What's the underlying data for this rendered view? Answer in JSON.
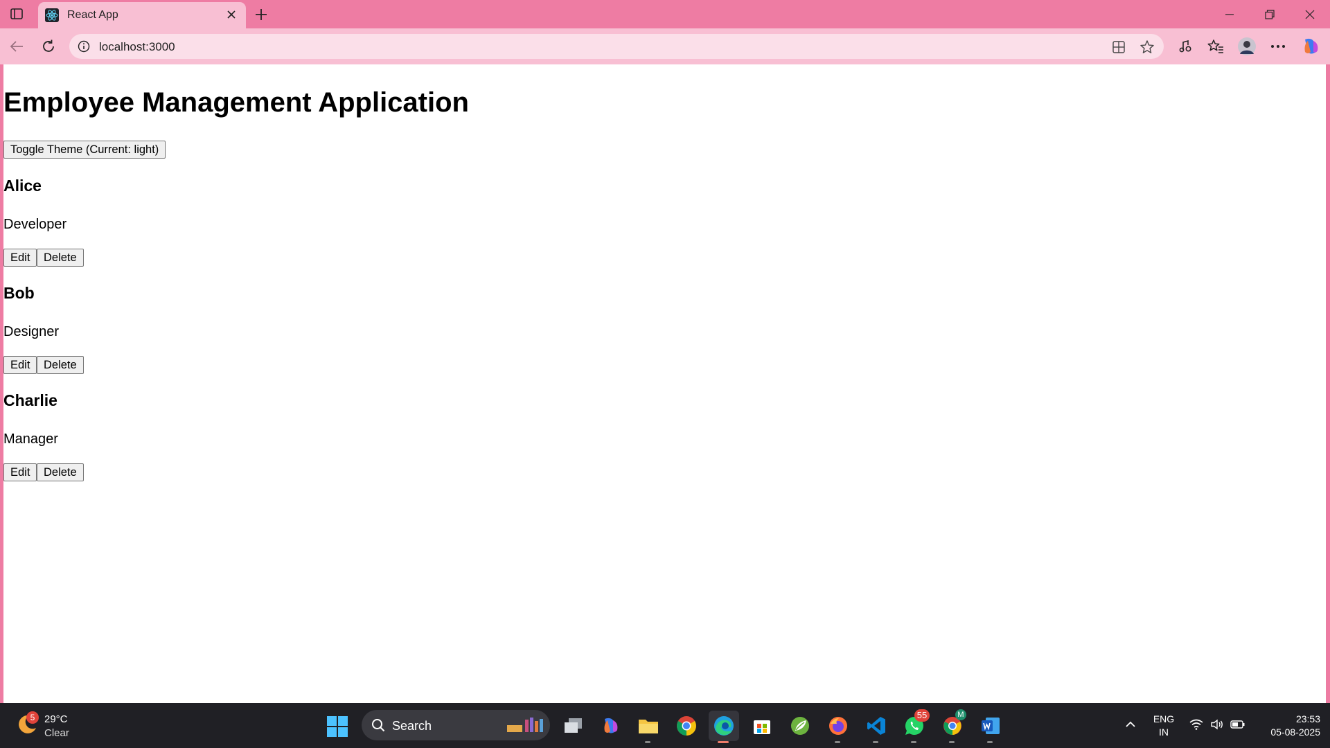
{
  "browser": {
    "tab_title": "React App",
    "url": "localhost:3000"
  },
  "page": {
    "heading": "Employee Management Application",
    "toggle_label": "Toggle Theme (Current: light)",
    "employees": [
      {
        "name": "Alice",
        "role": "Developer",
        "edit_label": "Edit",
        "delete_label": "Delete"
      },
      {
        "name": "Bob",
        "role": "Designer",
        "edit_label": "Edit",
        "delete_label": "Delete"
      },
      {
        "name": "Charlie",
        "role": "Manager",
        "edit_label": "Edit",
        "delete_label": "Delete"
      }
    ]
  },
  "taskbar": {
    "weather_badge": "5",
    "temperature": "29°C",
    "condition": "Clear",
    "search_label": "Search",
    "whatsapp_badge": "55",
    "chrome_profile_badge": "M",
    "lang_line1": "ENG",
    "lang_line2": "IN",
    "time": "23:53",
    "date": "05-08-2025"
  },
  "colors": {
    "chrome_frame": "#ee7ca3",
    "chrome_toolbar": "#f8bfd3",
    "taskbar": "#202025"
  }
}
